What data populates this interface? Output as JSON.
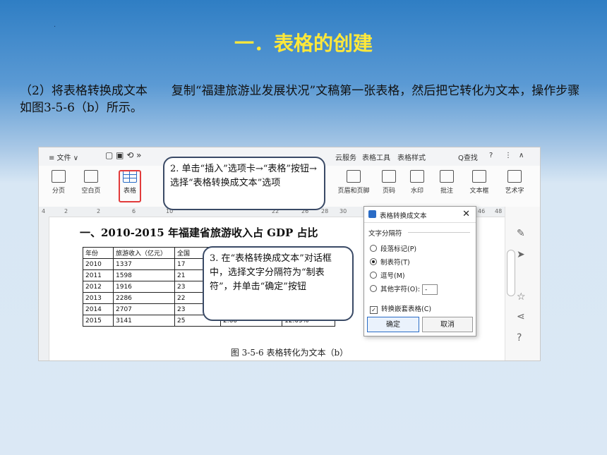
{
  "slide": {
    "dot": ".",
    "title": "一．表格的创建",
    "body": "（2）将表格转换成文本　　复制“福建旅游业发展状况”文稿第一张表格，然后把它转化为文本，操作步骤如图3-5-6（b）所示。"
  },
  "app": {
    "menu": {
      "file": "≡ 文件 ∨",
      "cloud": "云服务",
      "table_tools": "表格工具",
      "table_style": "表格样式",
      "search": "Q查找",
      "help": "?",
      "more": "⋮",
      "collapse": "∧"
    },
    "ribbon": {
      "pagebreak": "分页",
      "blankpage": "空白页",
      "table": "表格",
      "header_footer": "页眉和页脚",
      "pagenum": "页码",
      "watermark": "水印",
      "comment": "批注",
      "textbox": "文本框",
      "wordart": "艺术字"
    },
    "ruler_ticks": [
      "4",
      "2",
      "2",
      "6",
      "10",
      "22",
      "26",
      "28",
      "30",
      "46",
      "48"
    ]
  },
  "document": {
    "heading": "一、2010-2015 年福建省旅游收入占 GDP 占比",
    "table": {
      "headers": [
        "年份",
        "旅游收入（亿元）",
        "全国",
        "",
        ""
      ],
      "rows": [
        [
          "2010",
          "1337",
          "17",
          "",
          ""
        ],
        [
          "2011",
          "1598",
          "21",
          "",
          ""
        ],
        [
          "2012",
          "1916",
          "23",
          "",
          ""
        ],
        [
          "2013",
          "2286",
          "22",
          "",
          ""
        ],
        [
          "2014",
          "2707",
          "23",
          "",
          ""
        ],
        [
          "2015",
          "3141",
          "25",
          "2.60",
          "12.09%"
        ]
      ]
    },
    "caption": "图 3-5-6  表格转化为文本（b）"
  },
  "callouts": {
    "step2": "2. 单击“插入”选项卡→“表格”按钮→选择“表格转换成文本”选项",
    "step3": "3. 在“表格转换成文本”对话框中，选择文字分隔符为“制表符”，并单击“确定”按钮"
  },
  "dialog": {
    "title": "表格转换成文本",
    "section": "文字分隔符",
    "options": [
      "段落标记(P)",
      "制表符(T)",
      "逗号(M)",
      "其他字符(O):"
    ],
    "selected": "制表符(T)",
    "other_value": "-",
    "nested_checkbox": "转换嵌套表格(C)",
    "nested_checked": true,
    "ok": "确定",
    "cancel": "取消"
  }
}
